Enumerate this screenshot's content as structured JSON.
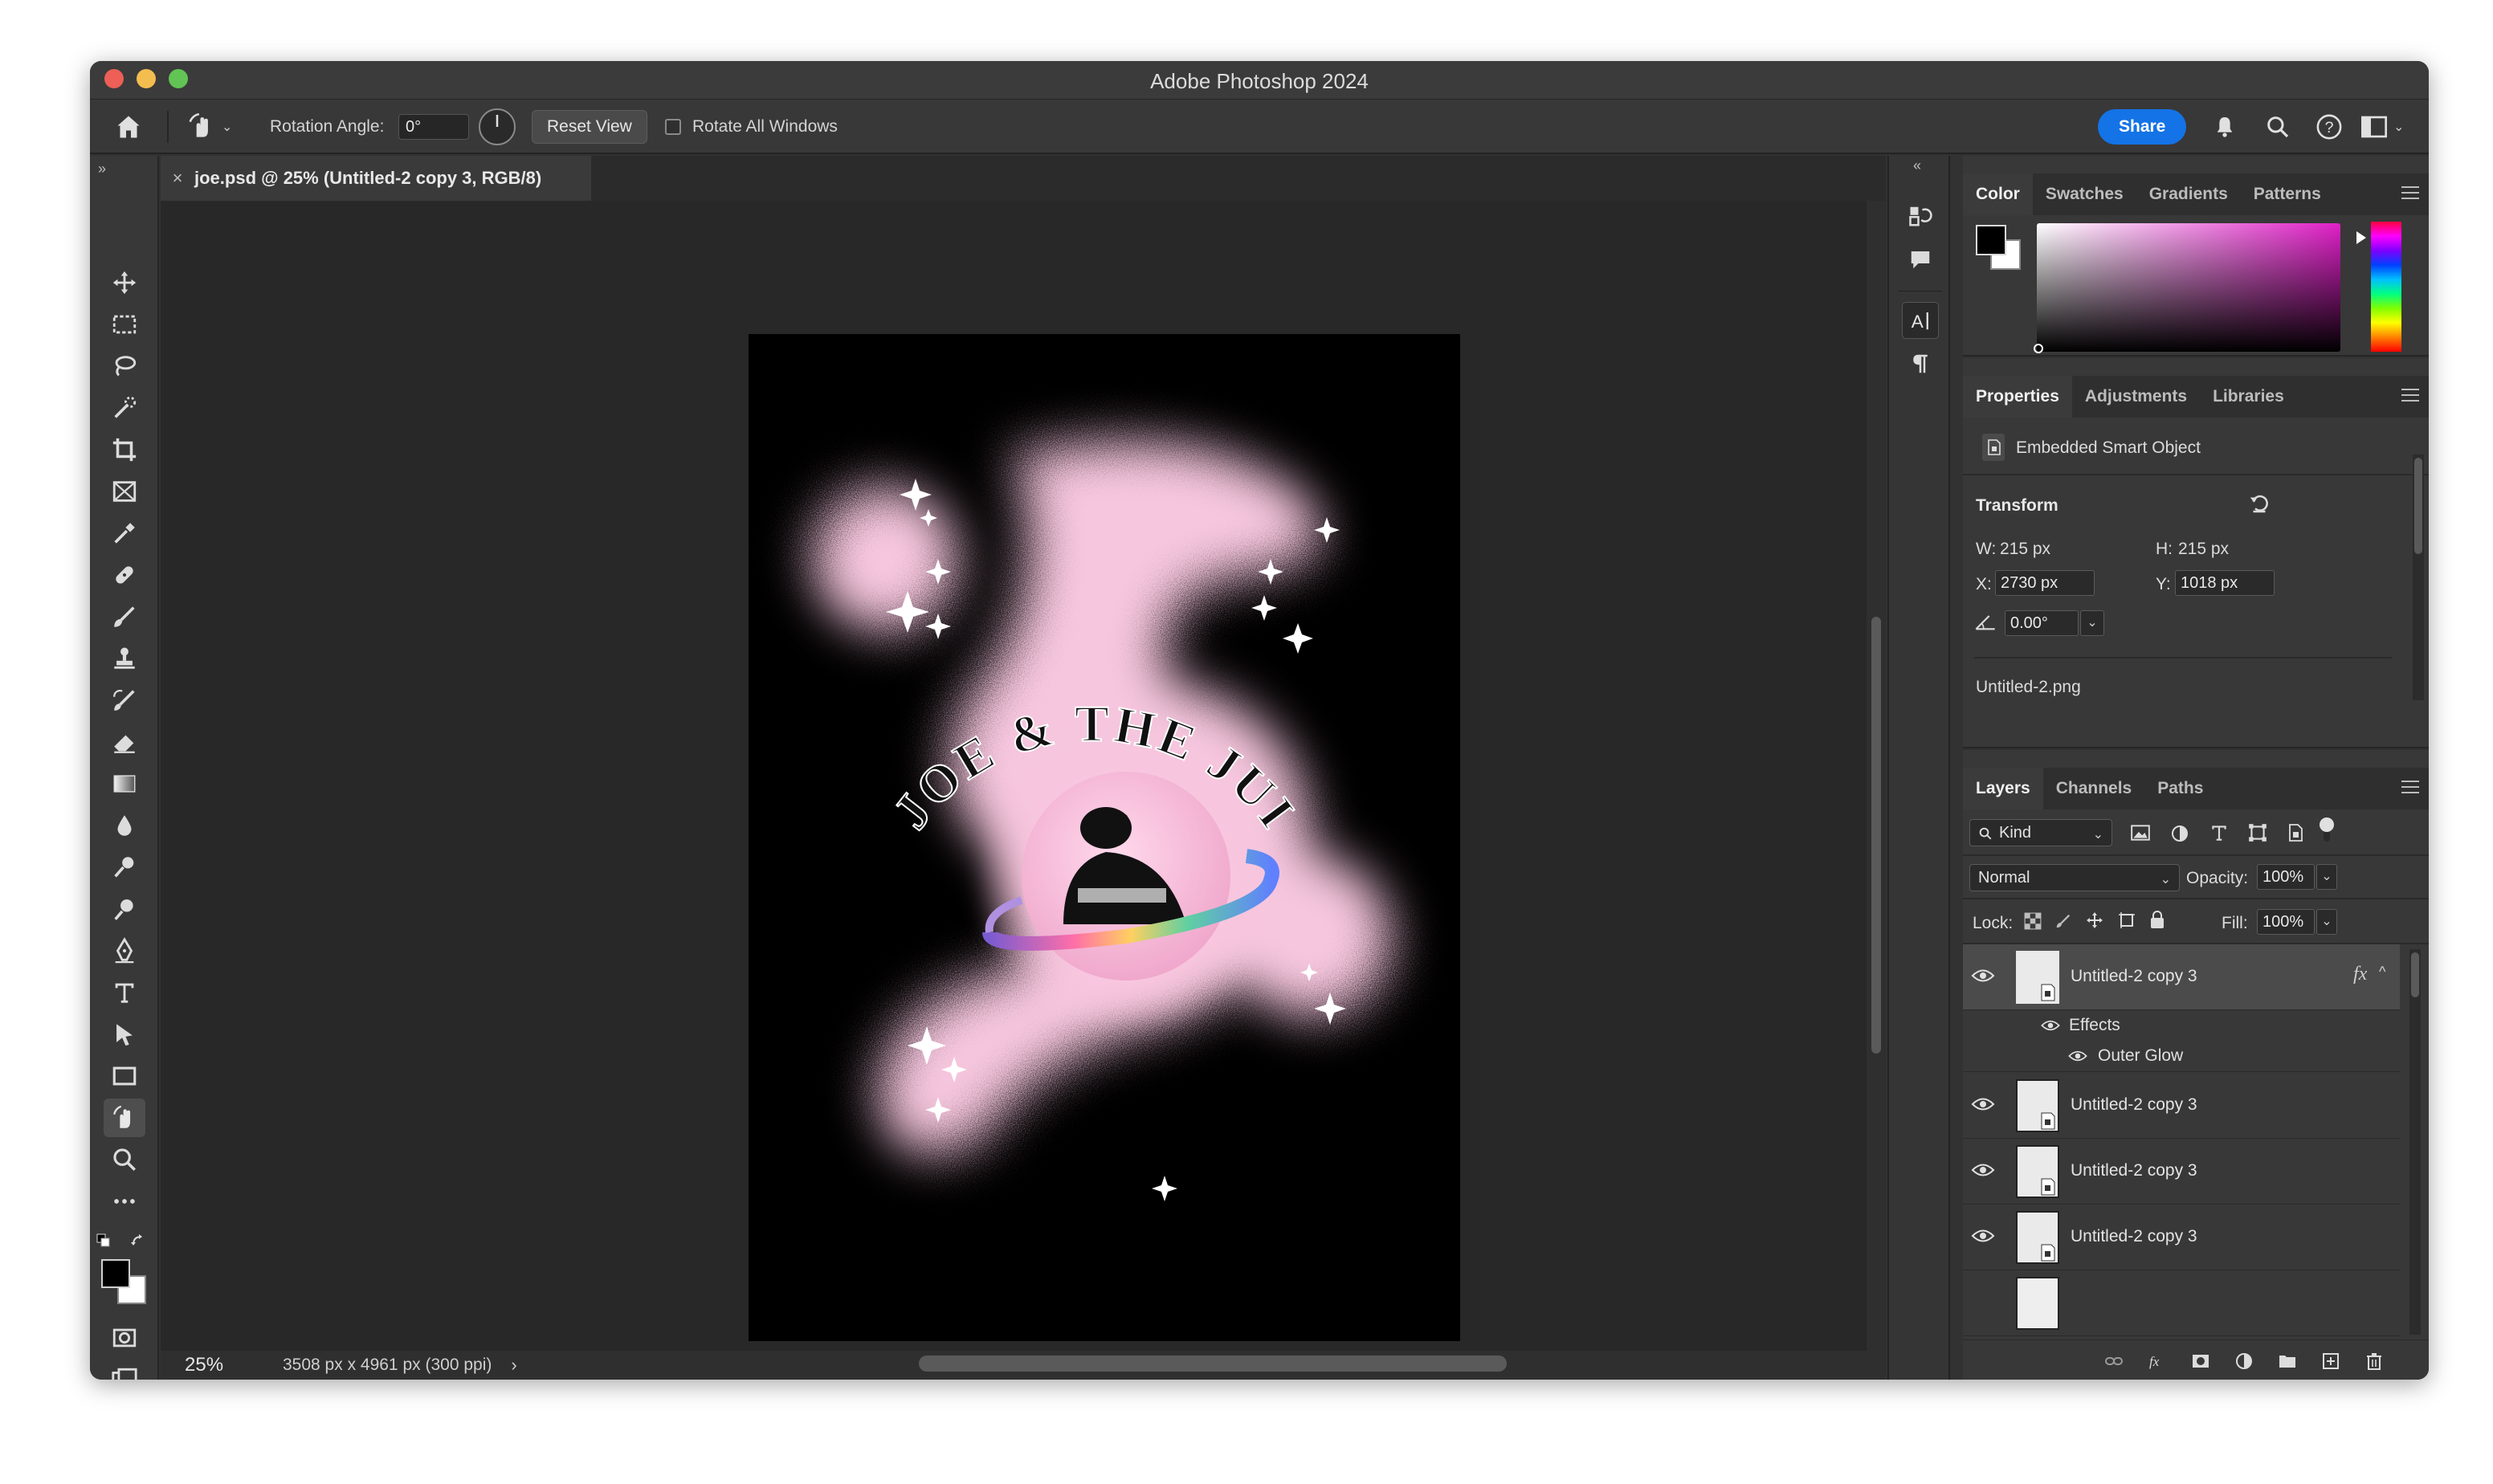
{
  "window": {
    "title": "Adobe Photoshop 2024"
  },
  "options_bar": {
    "rotation_label": "Rotation Angle:",
    "rotation_value": "0°",
    "reset_view": "Reset View",
    "rotate_all_windows": "Rotate All Windows",
    "rotate_all_checked": false,
    "share": "Share"
  },
  "document": {
    "tab_title": "joe.psd @ 25% (Untitled-2 copy 3, RGB/8)",
    "zoom": "25%",
    "info": "3508 px x 4961 px (300 ppi)",
    "artwork_text": "JOE & THE JUICE"
  },
  "colors": {
    "accent": "#1473e6",
    "foreground": "#000000",
    "background": "#ffffff",
    "artwork_pink": "#f6c6de"
  },
  "color_panel": {
    "tabs": [
      "Color",
      "Swatches",
      "Gradients",
      "Patterns"
    ]
  },
  "properties_panel": {
    "tabs": [
      "Properties",
      "Adjustments",
      "Libraries"
    ],
    "object_type": "Embedded Smart Object",
    "transform_label": "Transform",
    "w_label": "W:",
    "w_value": "215 px",
    "h_label": "H:",
    "h_value": "215 px",
    "x_label": "X:",
    "x_value": "2730 px",
    "y_label": "Y:",
    "y_value": "1018 px",
    "angle_value": "0.00°",
    "source_file": "Untitled-2.png"
  },
  "layers_panel": {
    "tabs": [
      "Layers",
      "Channels",
      "Paths"
    ],
    "filter": "Kind",
    "blend_mode": "Normal",
    "opacity_label": "Opacity:",
    "opacity_value": "100%",
    "lock_label": "Lock:",
    "fill_label": "Fill:",
    "fill_value": "100%",
    "fx_label": "fx",
    "effects_label": "Effects",
    "outer_glow_label": "Outer Glow",
    "layers": [
      {
        "name": "Untitled-2 copy 3",
        "selected": true,
        "has_fx": true
      },
      {
        "name": "Untitled-2 copy 3",
        "selected": false,
        "has_fx": false
      },
      {
        "name": "Untitled-2 copy 3",
        "selected": false,
        "has_fx": false
      },
      {
        "name": "Untitled-2 copy 3",
        "selected": false,
        "has_fx": false
      }
    ]
  },
  "icons": {
    "toolbar": [
      "move-icon",
      "marquee-icon",
      "lasso-icon",
      "quick-select-icon",
      "crop-icon",
      "frame-icon",
      "eyedropper-icon",
      "healing-icon",
      "brush-icon",
      "stamp-icon",
      "history-brush-icon",
      "eraser-icon",
      "gradient-icon",
      "blur-icon",
      "dodge-icon",
      "burn-icon",
      "pen-icon",
      "type-icon",
      "path-select-icon",
      "rectangle-icon",
      "hand-icon",
      "zoom-icon",
      "more-tools-icon"
    ]
  }
}
